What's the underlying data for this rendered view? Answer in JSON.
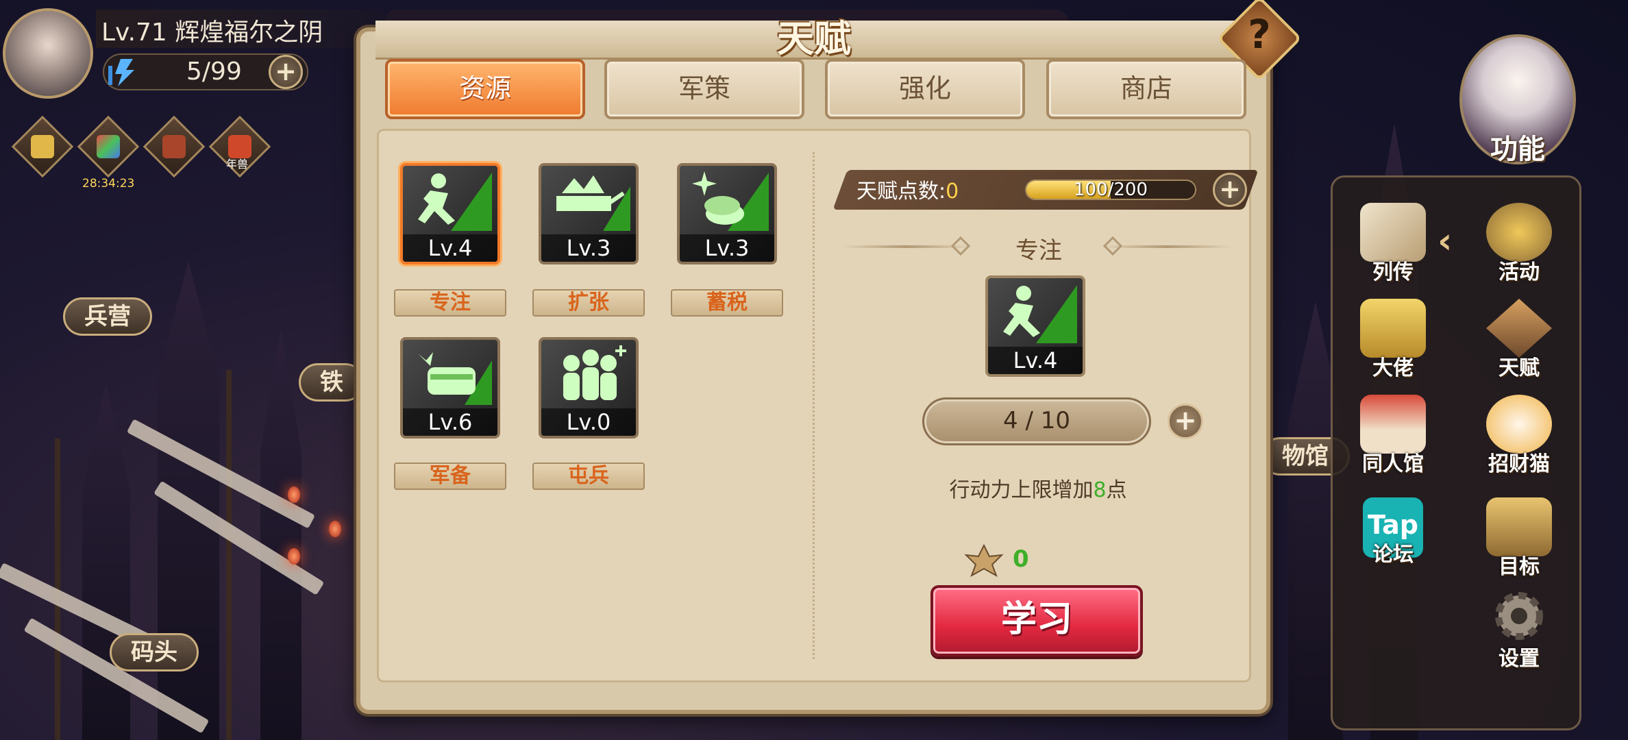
{
  "player": {
    "level_name": "Lv.71  辉煌福尔之阴",
    "energy": "5/99"
  },
  "hud": {
    "event_timer": "28:34:23",
    "event_icons": [
      "scroll-event-icon",
      "fireworks-event-icon",
      "gate-event-icon",
      "lobster-event-icon"
    ],
    "event_icon_label": "年兽"
  },
  "map": {
    "barracks": "兵营",
    "iron": "铁",
    "dock": "码头",
    "museum": "物馆"
  },
  "character": {
    "label": "功能"
  },
  "functions": [
    {
      "label": "列传",
      "icon": "scroll-book-icon"
    },
    {
      "label": "活动",
      "icon": "star-medal-icon"
    },
    {
      "label": "大佬",
      "icon": "boss-crown-icon"
    },
    {
      "label": "天赋",
      "icon": "talent-emblem-icon"
    },
    {
      "label": "同人馆",
      "icon": "pavilion-icon"
    },
    {
      "label": "招财猫",
      "icon": "lucky-cat-icon"
    },
    {
      "label": "论坛",
      "icon": "tap-forum-icon",
      "logo": "Tap"
    },
    {
      "label": "目标",
      "icon": "target-scroll-icon"
    },
    {
      "label": "设置",
      "icon": "gear-icon"
    }
  ],
  "dialog": {
    "title": "天赋",
    "help": "?",
    "tabs": [
      {
        "label": "资源",
        "active": true
      },
      {
        "label": "军策",
        "active": false
      },
      {
        "label": "强化",
        "active": false
      },
      {
        "label": "商店",
        "active": false
      }
    ],
    "talents": [
      {
        "name": "专注",
        "level": "Lv.4",
        "icon": "running-man-icon",
        "selected": true
      },
      {
        "name": "扩张",
        "level": "Lv.3",
        "icon": "ore-cart-icon",
        "selected": false
      },
      {
        "name": "蓄税",
        "level": "Lv.3",
        "icon": "coins-icon",
        "selected": false
      },
      {
        "name": "军备",
        "level": "Lv.6",
        "icon": "armor-chest-icon",
        "selected": false
      },
      {
        "name": "屯兵",
        "level": "Lv.0",
        "icon": "soldiers-icon",
        "selected": false
      }
    ],
    "points": {
      "label": "天赋点数:",
      "value": "0",
      "progress_text_current": "100",
      "progress_text_max": "/200",
      "progress_fraction": 0.5
    },
    "detail": {
      "name": "专注",
      "level": "Lv.4",
      "progress": "4 / 10",
      "effect_prefix": "行动力上限增加",
      "effect_value": "8",
      "effect_suffix": "点",
      "cost": "0",
      "learn": "学习"
    }
  },
  "colors": {
    "active_tab": "#ef7a2e",
    "talent_glow": "#3fae2a",
    "learn_button": "#e2283f",
    "points_value": "#ffd24a"
  }
}
